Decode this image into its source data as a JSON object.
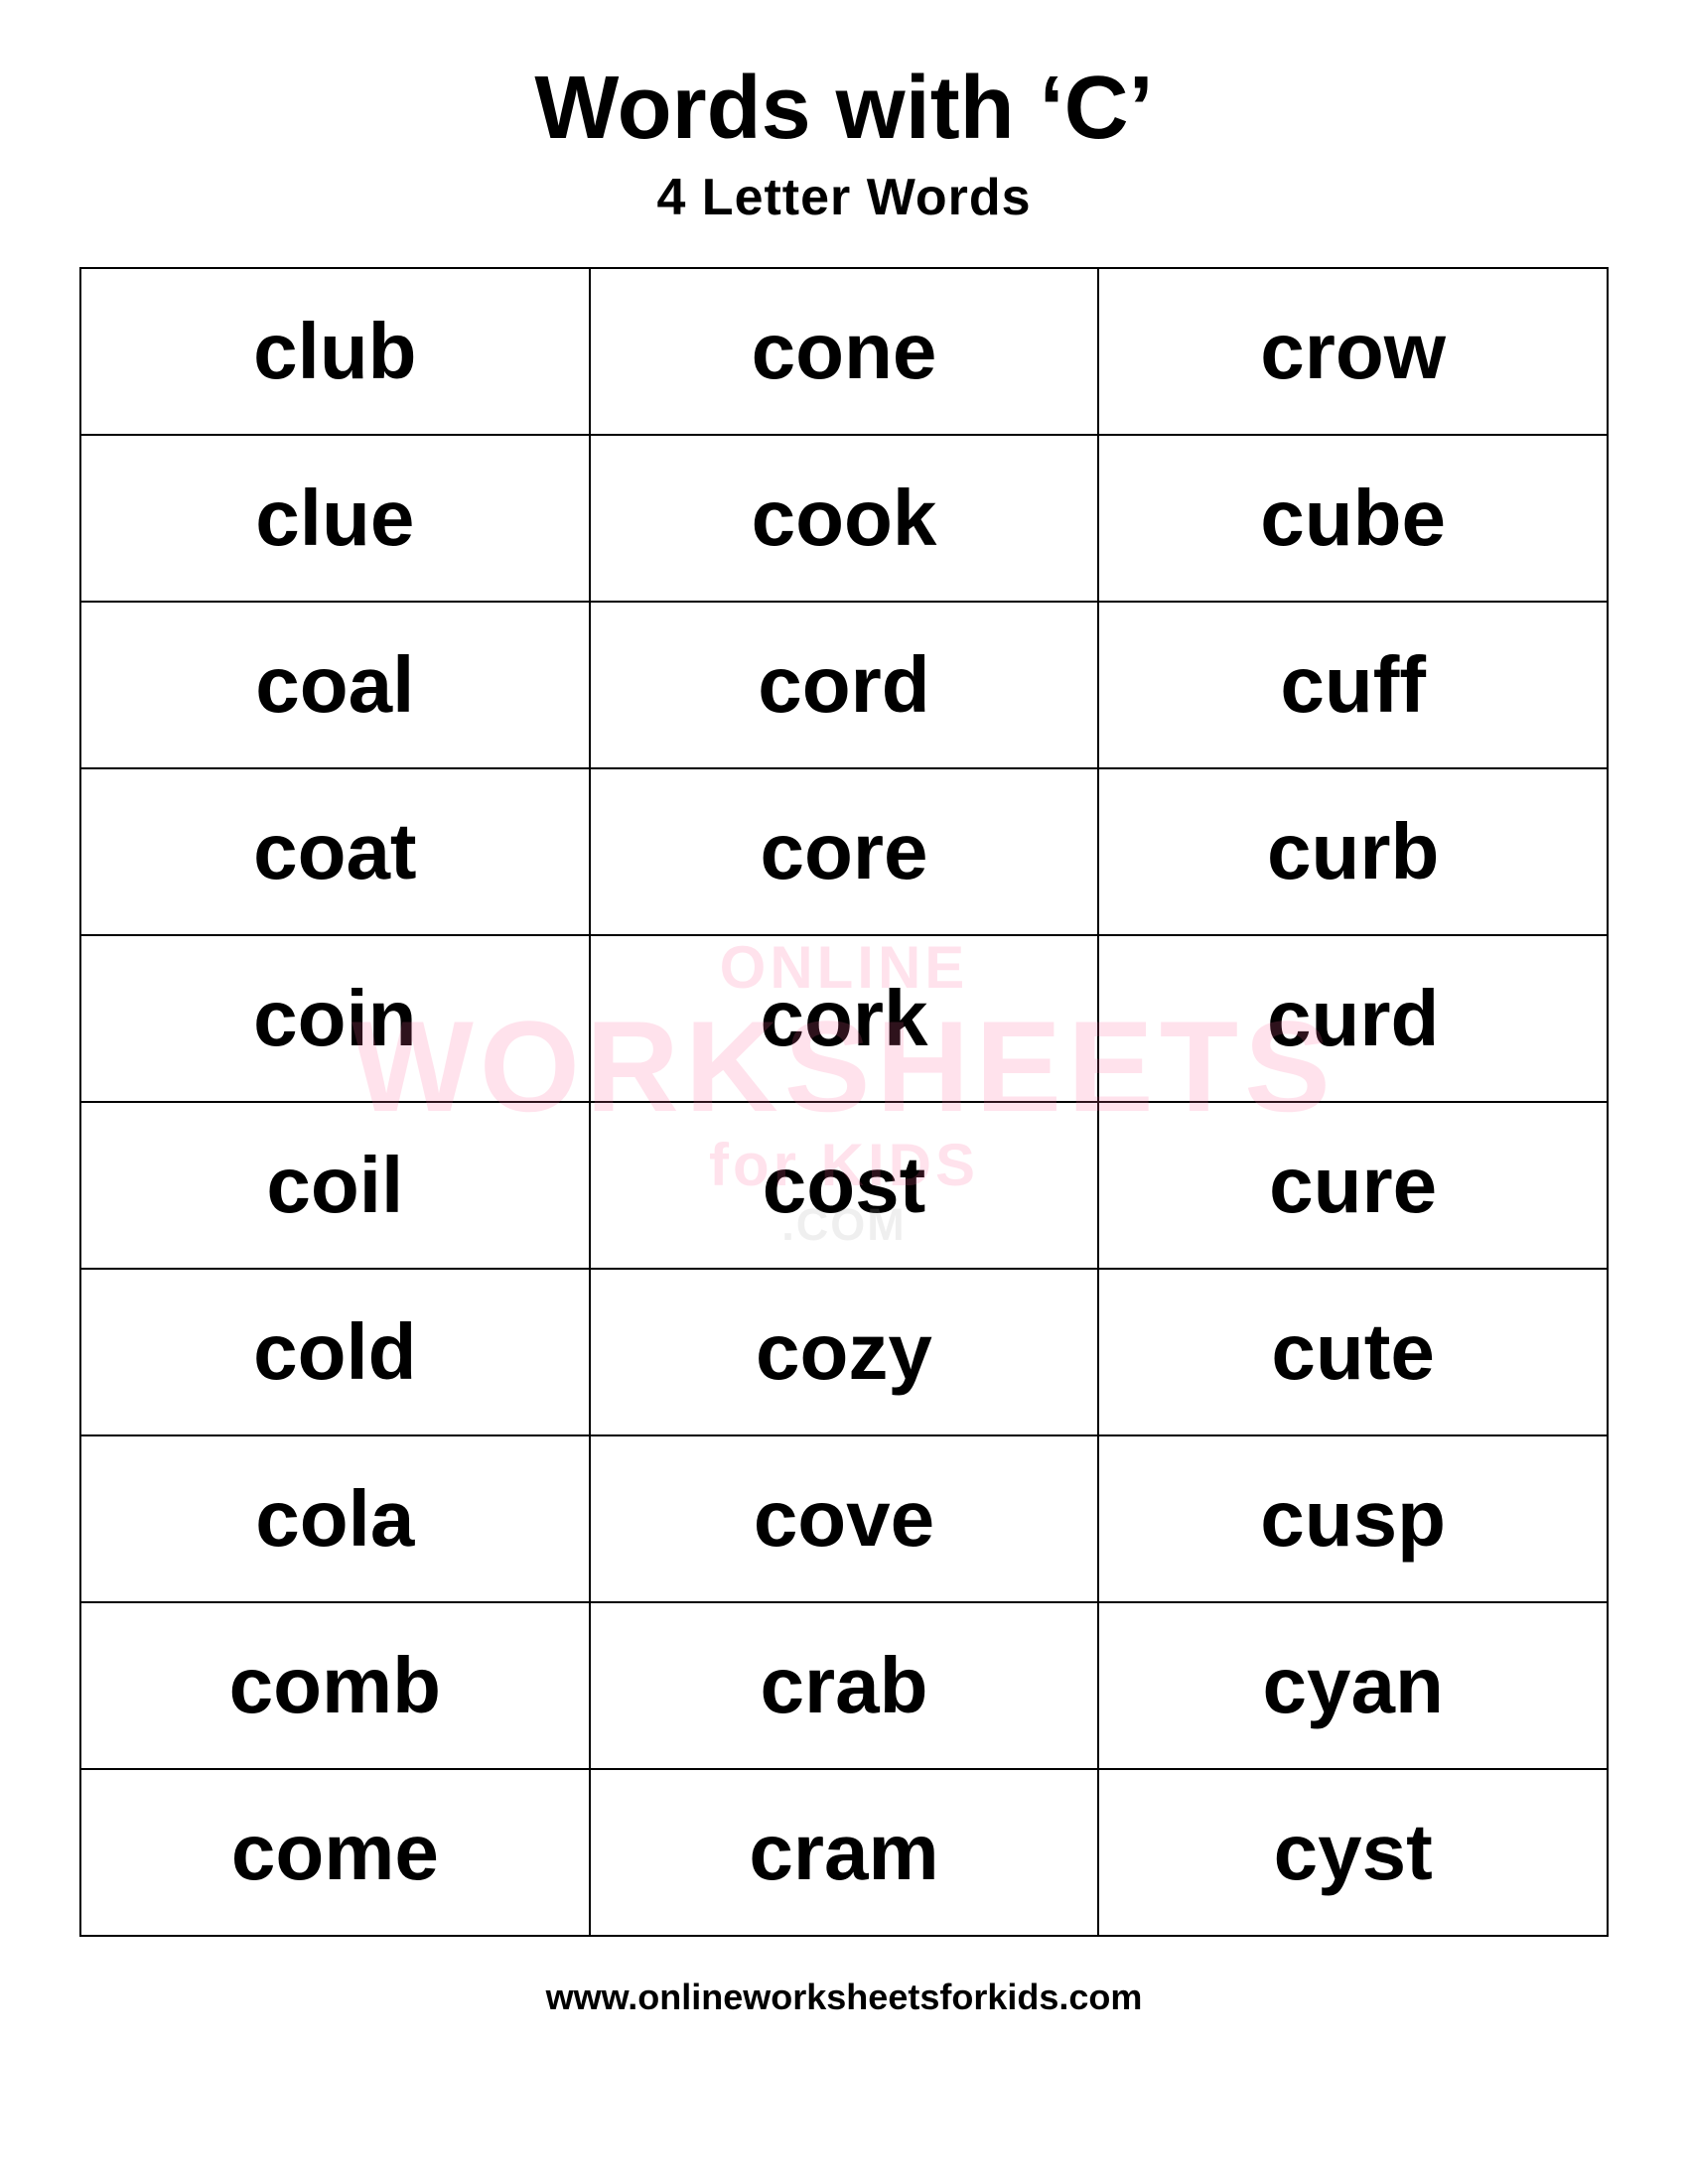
{
  "header": {
    "title": "Words with ‘C’",
    "subtitle": "4 Letter Words"
  },
  "table": {
    "rows": [
      [
        "club",
        "cone",
        "crow"
      ],
      [
        "clue",
        "cook",
        "cube"
      ],
      [
        "coal",
        "cord",
        "cuff"
      ],
      [
        "coat",
        "core",
        "curb"
      ],
      [
        "coin",
        "cork",
        "curd"
      ],
      [
        "coil",
        "cost",
        "cure"
      ],
      [
        "cold",
        "cozy",
        "cute"
      ],
      [
        "cola",
        "cove",
        "cusp"
      ],
      [
        "comb",
        "crab",
        "cyan"
      ],
      [
        "come",
        "cram",
        "cyst"
      ]
    ]
  },
  "watermark": {
    "online": "ONLINE",
    "worksheets": "WORKSHEETS",
    "for_kids": "for KIDS",
    "com": ".COM"
  },
  "footer": {
    "url": "www.onlineworksheetsforkids.com"
  }
}
